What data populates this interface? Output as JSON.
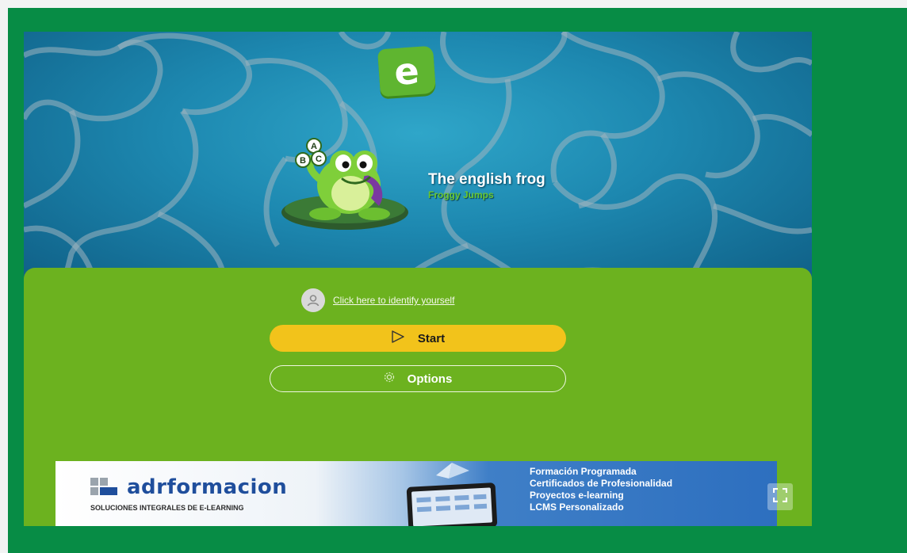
{
  "game": {
    "logo_letter": "e",
    "title": "The english frog",
    "subtitle": "Froggy Jumps"
  },
  "frog_letters": [
    "A",
    "B",
    "C"
  ],
  "actions": {
    "identify_link": "Click here to identify yourself",
    "start_label": "Start",
    "options_label": "Options"
  },
  "banner": {
    "brand": "adrformacion",
    "tagline": "SOLUCIONES INTEGRALES DE E-LEARNING",
    "services": [
      "Formación Programada",
      "Certificados de Profesionalidad",
      "Proyectos e-learning",
      "LCMS Personalizado"
    ]
  },
  "icons": {
    "avatar": "user-icon",
    "start": "play-icon",
    "options": "gear-icon",
    "fullscreen": "fullscreen-icon"
  },
  "colors": {
    "page_background": "#078c45",
    "panel": "#6cb21f",
    "start_button": "#f2c31b",
    "logo": "#5fb530",
    "water": "#1d88b0"
  }
}
